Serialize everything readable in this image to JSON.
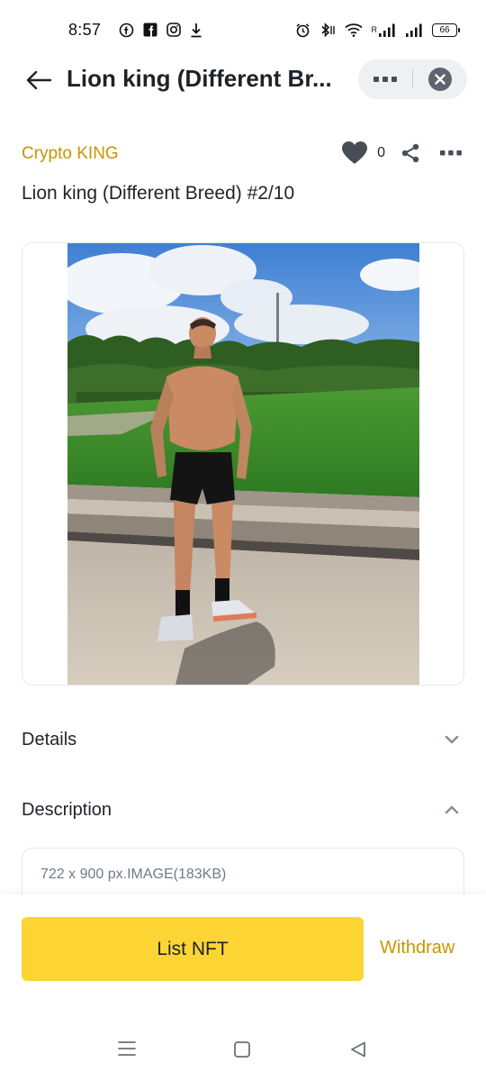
{
  "status_bar": {
    "time": "8:57",
    "left_icons": [
      "facebook-messenger-icon",
      "facebook-icon",
      "instagram-icon",
      "download-icon"
    ],
    "right_icons": [
      "alarm-icon",
      "bluetooth-icon",
      "wifi-icon",
      "signal-icon",
      "signal-icon"
    ],
    "roaming_label": "R",
    "battery_level": "66"
  },
  "header": {
    "title": "Lion king (Different Br...",
    "back_icon": "arrow-left-icon",
    "more_icon": "more-dots-icon",
    "close_icon": "close-circle-icon"
  },
  "nft": {
    "collection": "Crypto KING",
    "title": "Lion king (Different Breed) #2/10",
    "like_count": "0"
  },
  "sections": {
    "details_label": "Details",
    "description_label": "Description",
    "description_text": "722 x 900 px.IMAGE(183KB)"
  },
  "actions": {
    "list_label": "List NFT",
    "withdraw_label": "Withdraw"
  },
  "colors": {
    "accent": "#c99400",
    "primary_button": "#fcd535",
    "text": "#1e2329",
    "muted": "#707a8a"
  }
}
